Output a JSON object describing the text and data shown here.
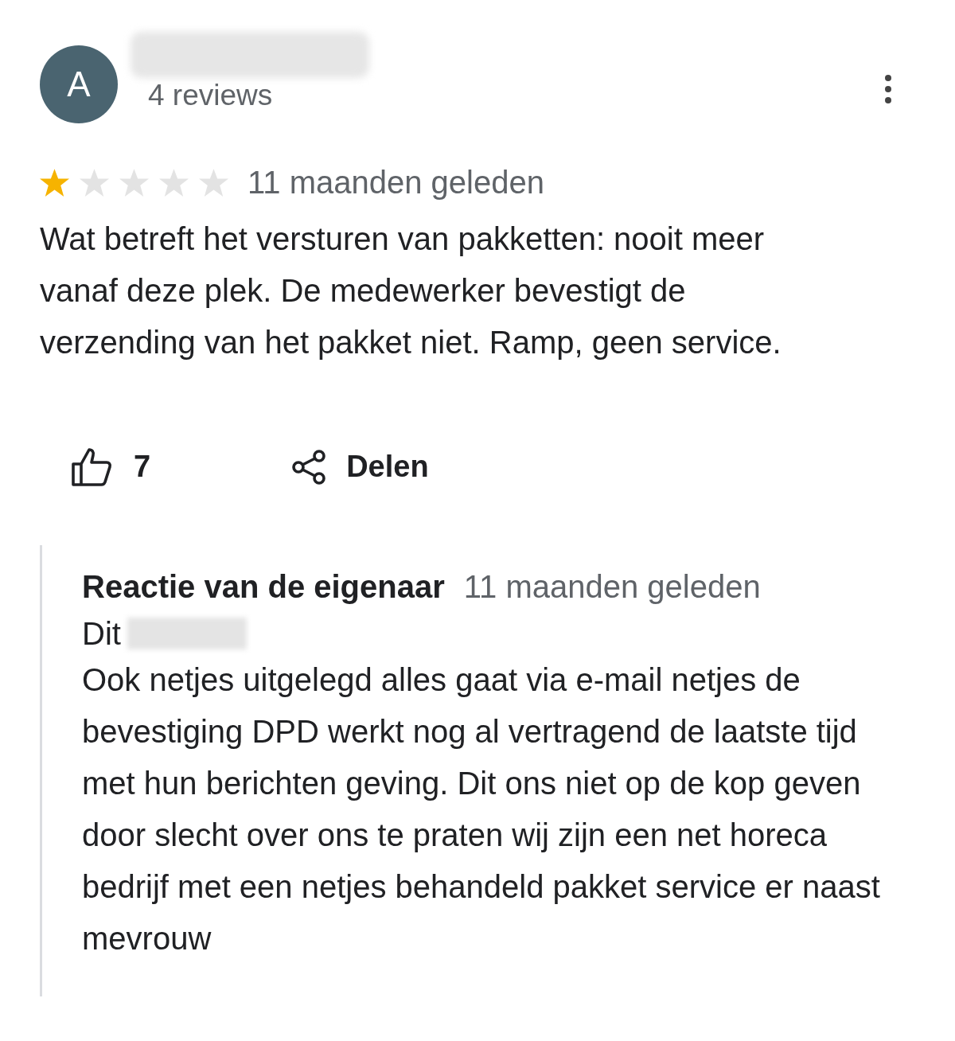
{
  "reviewer": {
    "avatar_letter": "A",
    "name_redacted": true,
    "review_count": "4 reviews"
  },
  "review": {
    "stars": 1,
    "time": "11 maanden geleden",
    "text": "Wat betreft het versturen van pakketten: nooit meer vanaf deze plek. De medewerker bevestigt de verzending van het pakket niet. Ramp, geen service."
  },
  "actions": [
    {
      "kind": "like",
      "label": "7"
    },
    {
      "kind": "share",
      "label": "Delen"
    }
  ],
  "owner_response": {
    "title": "Reactie van de eigenaar",
    "time": "11 maanden geleden",
    "greeting": "Dit",
    "greeting_redacted": true,
    "text": "Ook netjes uitgelegd alles gaat via e-mail netjes de bevestiging DPD werkt nog al vertragend de laatste tijd met hun berichten geving. Dit ons niet op de kop geven door slecht over ons te praten wij zijn een net horeca bedrijf met een netjes behandeld pakket service er naast mevrouw"
  }
}
